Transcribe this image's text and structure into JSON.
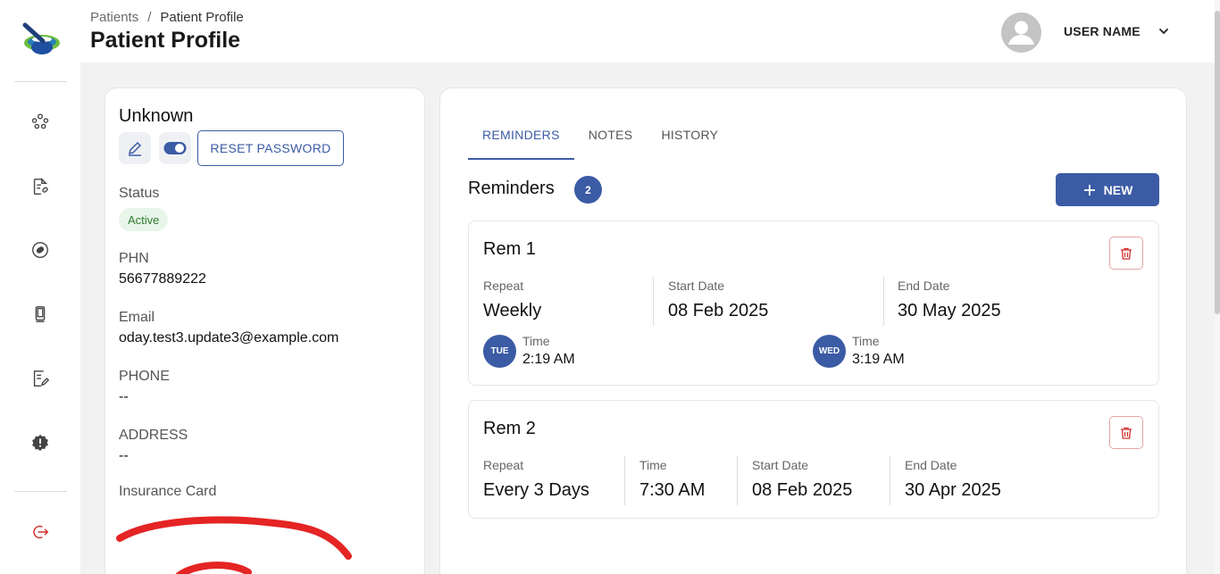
{
  "nav": {
    "items": [
      {
        "name": "patients-icon"
      },
      {
        "name": "prescriptions-icon"
      },
      {
        "name": "medications-icon"
      },
      {
        "name": "devices-icon"
      },
      {
        "name": "reports-icon"
      },
      {
        "name": "alerts-icon"
      },
      {
        "name": "logout-icon"
      }
    ]
  },
  "header": {
    "breadcrumb_root": "Patients",
    "breadcrumb_separator": "/",
    "breadcrumb_current": "Patient Profile",
    "title": "Patient Profile",
    "user_name": "USER NAME"
  },
  "profile": {
    "name": "Unknown",
    "reset_password_label": "RESET PASSWORD",
    "status_label": "Status",
    "status_value": "Active",
    "phn_label": "PHN",
    "phn_value": "56677889222",
    "email_label": "Email",
    "email_value": "oday.test3.update3@example.com",
    "phone_label": "PHONE",
    "phone_value": "--",
    "address_label": "ADDRESS",
    "address_value": "--",
    "insurance_label": "Insurance Card"
  },
  "tabs": [
    "REMINDERS",
    "NOTES",
    "HISTORY"
  ],
  "reminders": {
    "title": "Reminders",
    "count": "2",
    "new_label": "NEW",
    "items": [
      {
        "title": "Rem 1",
        "repeat_label": "Repeat",
        "repeat_value": "Weekly",
        "start_label": "Start Date",
        "start_value": "08 Feb 2025",
        "end_label": "End Date",
        "end_value": "30 May 2025",
        "times": [
          {
            "day": "TUE",
            "label": "Time",
            "value": "2:19 AM"
          },
          {
            "day": "WED",
            "label": "Time",
            "value": "3:19 AM"
          }
        ]
      },
      {
        "title": "Rem 2",
        "repeat_label": "Repeat",
        "repeat_value": "Every 3 Days",
        "time_label": "Time",
        "time_value": "7:30 AM",
        "start_label": "Start Date",
        "start_value": "08 Feb 2025",
        "end_label": "End Date",
        "end_value": "30 Apr 2025"
      }
    ]
  },
  "colors": {
    "primary": "#3b5ba5",
    "success_bg": "#e8f5e9",
    "success_text": "#2e7d32",
    "danger": "#d32f2f"
  }
}
